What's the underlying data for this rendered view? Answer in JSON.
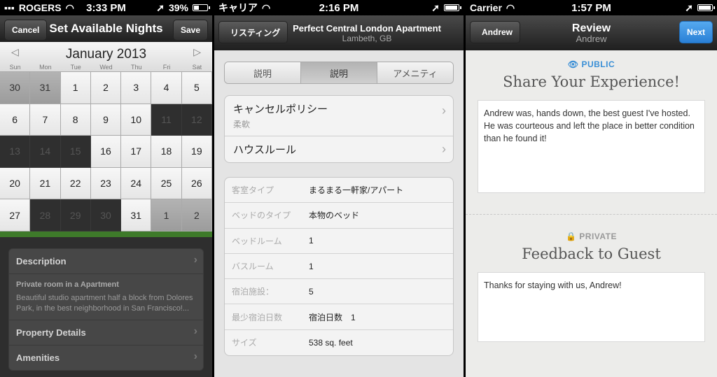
{
  "panel1": {
    "status": {
      "carrier": "ROGERS",
      "time": "3:33 PM",
      "battery": "39%"
    },
    "nav": {
      "cancel": "Cancel",
      "title": "Set Available Nights",
      "save": "Save"
    },
    "calendar": {
      "month": "January 2013",
      "prev": "◁",
      "next": "▷",
      "weekdays": [
        "Sun",
        "Mon",
        "Tue",
        "Wed",
        "Thu",
        "Fri",
        "Sat"
      ],
      "weeks": [
        [
          {
            "d": "30",
            "s": "g"
          },
          {
            "d": "31",
            "s": "g"
          },
          {
            "d": "1",
            "s": ""
          },
          {
            "d": "2",
            "s": ""
          },
          {
            "d": "3",
            "s": ""
          },
          {
            "d": "4",
            "s": ""
          },
          {
            "d": "5",
            "s": ""
          }
        ],
        [
          {
            "d": "6",
            "s": ""
          },
          {
            "d": "7",
            "s": ""
          },
          {
            "d": "8",
            "s": ""
          },
          {
            "d": "9",
            "s": ""
          },
          {
            "d": "10",
            "s": ""
          },
          {
            "d": "11",
            "s": "b"
          },
          {
            "d": "12",
            "s": "b"
          }
        ],
        [
          {
            "d": "13",
            "s": "b"
          },
          {
            "d": "14",
            "s": "b"
          },
          {
            "d": "15",
            "s": "b"
          },
          {
            "d": "16",
            "s": ""
          },
          {
            "d": "17",
            "s": ""
          },
          {
            "d": "18",
            "s": ""
          },
          {
            "d": "19",
            "s": ""
          }
        ],
        [
          {
            "d": "20",
            "s": ""
          },
          {
            "d": "21",
            "s": ""
          },
          {
            "d": "22",
            "s": ""
          },
          {
            "d": "23",
            "s": ""
          },
          {
            "d": "24",
            "s": ""
          },
          {
            "d": "25",
            "s": ""
          },
          {
            "d": "26",
            "s": ""
          }
        ],
        [
          {
            "d": "27",
            "s": ""
          },
          {
            "d": "28",
            "s": "b"
          },
          {
            "d": "29",
            "s": "b"
          },
          {
            "d": "30",
            "s": "b"
          },
          {
            "d": "31",
            "s": ""
          },
          {
            "d": "1",
            "s": "g"
          },
          {
            "d": "2",
            "s": "g"
          }
        ]
      ]
    },
    "list": {
      "description": "Description",
      "desc_title": "Private room in a Apartment",
      "desc_text": "Beautiful studio apartment half a block from Dolores Park, in the best neighborhood in San Francisco!...",
      "property": "Property Details",
      "amenities": "Amenities"
    }
  },
  "panel2": {
    "status": {
      "carrier": "キャリア",
      "time": "2:16 PM"
    },
    "nav": {
      "back": "リスティング",
      "title": "Perfect Central London Apartment",
      "subtitle": "Lambeth, GB"
    },
    "tabs": [
      "説明",
      "説明",
      "アメニティ"
    ],
    "policy": {
      "label": "キャンセルポリシー",
      "value": "柔軟",
      "house_rules": "ハウスルール"
    },
    "table": [
      {
        "k": "客室タイプ",
        "v": "まるまる一軒家/アパート"
      },
      {
        "k": "ベッドのタイプ",
        "v": "本物のベッド"
      },
      {
        "k": "ベッドルーム",
        "v": "1"
      },
      {
        "k": "バスルーム",
        "v": "1"
      },
      {
        "k": "宿泊施設：",
        "v": "5"
      },
      {
        "k": "最少宿泊日数",
        "v": "宿泊日数　1"
      },
      {
        "k": "サイズ",
        "v": "538 sq. feet"
      }
    ]
  },
  "panel3": {
    "status": {
      "carrier": "Carrier",
      "time": "1:57 PM"
    },
    "nav": {
      "back": "Andrew",
      "title": "Review",
      "subtitle": "Andrew",
      "next": "Next"
    },
    "public": {
      "label": "PUBLIC",
      "title": "Share Your Experience!",
      "text": "Andrew was, hands down, the best guest I've hosted. He was courteous and left the place in better condition than he found it!"
    },
    "private": {
      "label": "PRIVATE",
      "title": "Feedback to Guest",
      "text": "Thanks for staying with us, Andrew!"
    },
    "colors": {
      "accent": "#2a80d6",
      "public_label": "#3a8fd6",
      "private_label": "#999999"
    }
  }
}
